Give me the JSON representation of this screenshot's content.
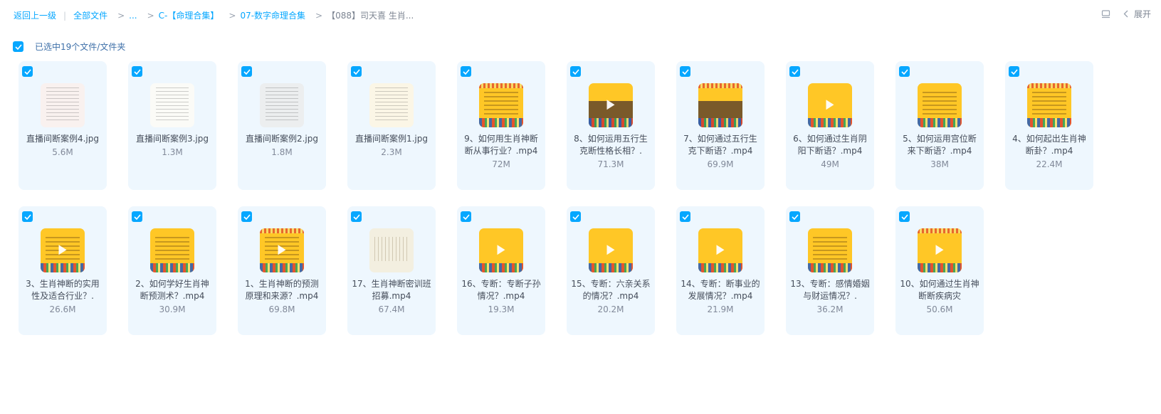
{
  "breadcrumb": {
    "back": "返回上一级",
    "items": [
      "全部文件",
      "...",
      "C-【命理合集】",
      "07-数字命理合集"
    ],
    "current": "【088】司天喜 生肖..."
  },
  "top_right": {
    "expand_label": "展开"
  },
  "selection": {
    "label": "已选中19个文件/文件夹"
  },
  "files_row1": [
    {
      "name": "直播间断案例4.jpg",
      "size": "5.6M"
    },
    {
      "name": "直播间断案例3.jpg",
      "size": "1.3M"
    },
    {
      "name": "直播间断案例2.jpg",
      "size": "1.8M"
    },
    {
      "name": "直播间断案例1.jpg",
      "size": "2.3M"
    },
    {
      "name": "9、如何用生肖神断断从事行业？.mp4",
      "size": "72M"
    },
    {
      "name": "8、如何运用五行生克断性格长相？.",
      "size": "71.3M"
    },
    {
      "name": "7、如何通过五行生克下断语？.mp4",
      "size": "69.9M"
    },
    {
      "name": "6、如何通过生肖阴阳下断语？.mp4",
      "size": "49M"
    },
    {
      "name": "5、如何运用宫位断来下断语？.mp4",
      "size": "38M"
    },
    {
      "name": "4、如何起出生肖神断卦？.mp4",
      "size": "22.4M"
    }
  ],
  "files_row2": [
    {
      "name": "3、生肖神断的实用性及适合行业？.",
      "size": "26.6M"
    },
    {
      "name": "2、如何学好生肖神断预测术？.mp4",
      "size": "30.9M"
    },
    {
      "name": "1、生肖神断的预测原理和来源？.mp4",
      "size": "69.8M"
    },
    {
      "name": "17、生肖神断密训班招募.mp4",
      "size": "67.4M"
    },
    {
      "name": "16、专断：专断子孙情况？.mp4",
      "size": "19.3M"
    },
    {
      "name": "15、专断：六亲关系的情况？.mp4",
      "size": "20.2M"
    },
    {
      "name": "14、专断：断事业的发展情况？.mp4",
      "size": "21.9M"
    },
    {
      "name": "13、专断：感情婚姻与财运情况？.",
      "size": "36.2M"
    },
    {
      "name": "10、如何通过生肖神断断疾病灾",
      "size": "50.6M"
    }
  ]
}
